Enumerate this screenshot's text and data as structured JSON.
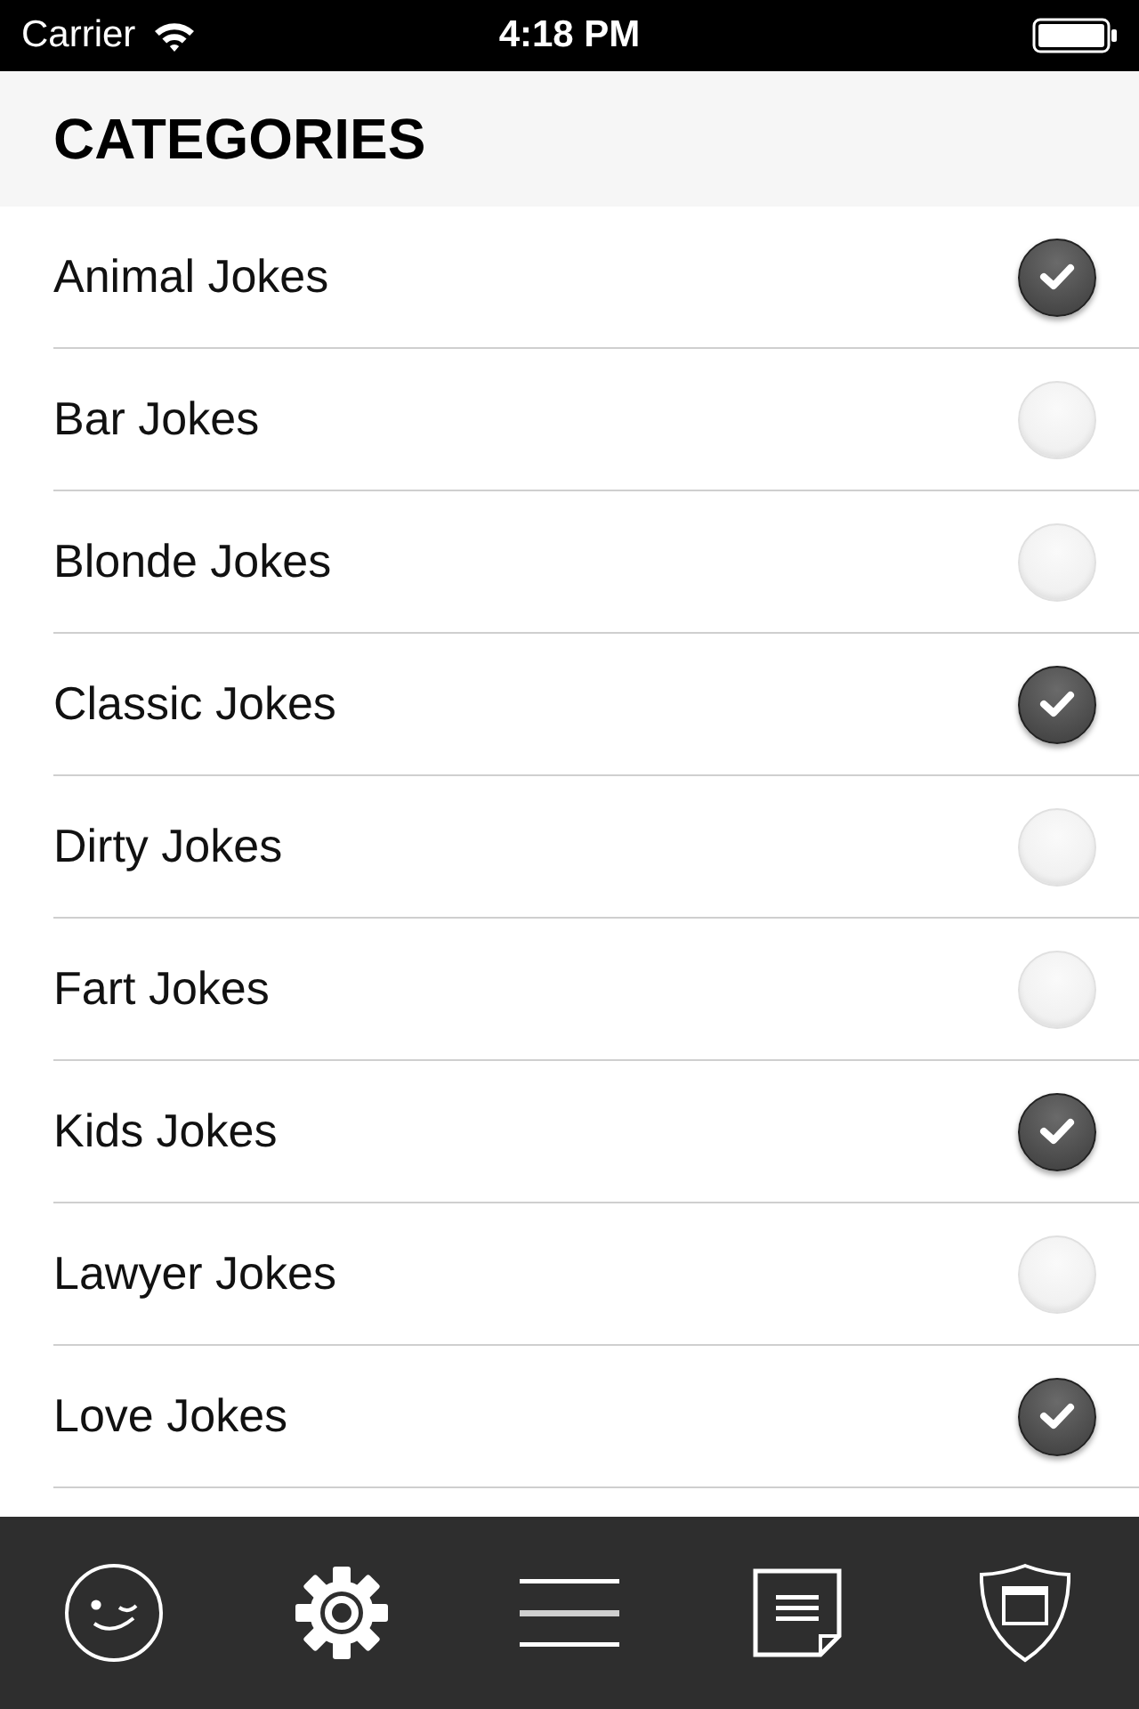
{
  "status_bar": {
    "carrier": "Carrier",
    "time": "4:18 PM"
  },
  "header": {
    "title": "CATEGORIES"
  },
  "categories": [
    {
      "label": "Animal Jokes",
      "checked": true
    },
    {
      "label": "Bar Jokes",
      "checked": false
    },
    {
      "label": "Blonde Jokes",
      "checked": false
    },
    {
      "label": "Classic Jokes",
      "checked": true
    },
    {
      "label": "Dirty Jokes",
      "checked": false
    },
    {
      "label": "Fart Jokes",
      "checked": false
    },
    {
      "label": "Kids Jokes",
      "checked": true
    },
    {
      "label": "Lawyer Jokes",
      "checked": false
    },
    {
      "label": "Love Jokes",
      "checked": true
    }
  ],
  "tab_bar": {
    "items": [
      {
        "kind": "smiley"
      },
      {
        "kind": "gear"
      },
      {
        "kind": "menu"
      },
      {
        "kind": "note"
      },
      {
        "kind": "shield"
      }
    ]
  }
}
